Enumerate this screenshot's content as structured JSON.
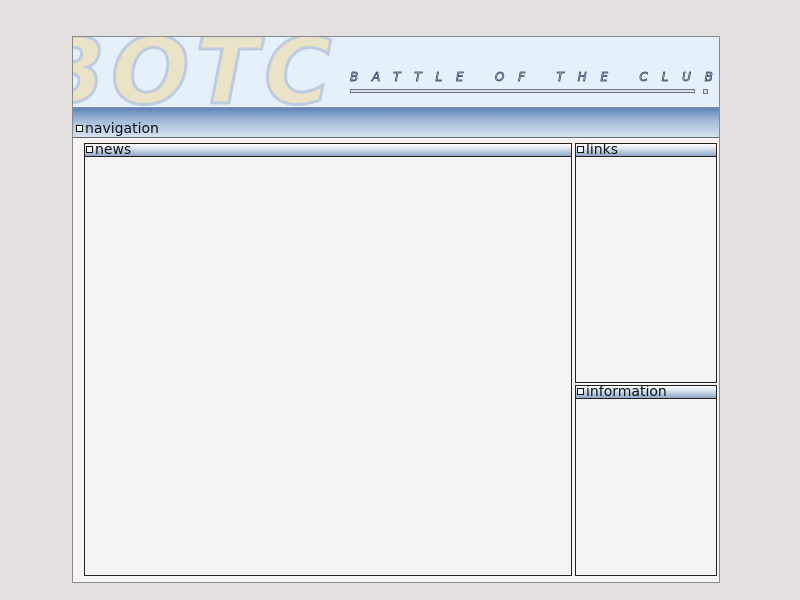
{
  "header": {
    "logo_text": "BOTC",
    "tagline": "BATTLE OF THE CLUBS"
  },
  "navigation": {
    "label": "navigation"
  },
  "panels": {
    "news": {
      "title": "news"
    },
    "links": {
      "title": "links"
    },
    "information": {
      "title": "information"
    }
  },
  "colors": {
    "background": "#e3e0df",
    "banner": "#e5f0fb",
    "logo_fill": "#ebe3c8",
    "logo_outline": "#bfcbe0",
    "nav_gradient_top": "#5f84b7",
    "nav_gradient_bottom": "#d6e3f1"
  }
}
